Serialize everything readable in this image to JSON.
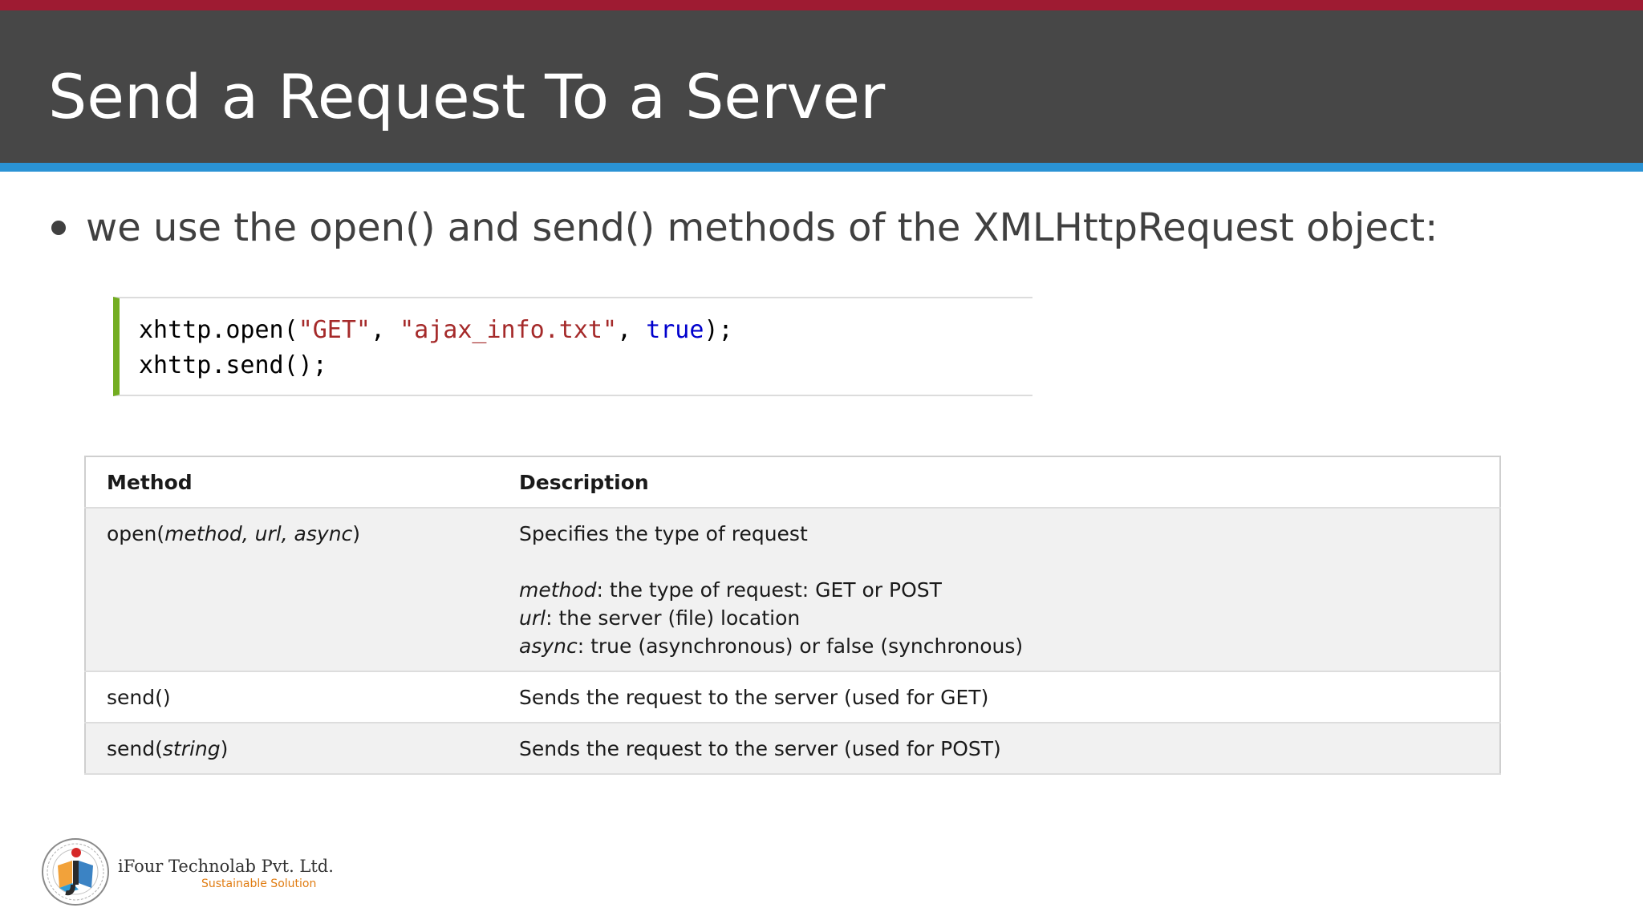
{
  "slide": {
    "title": "Send a Request To a Server",
    "bullet": "we use the open() and send() methods of the XMLHttpRequest object:"
  },
  "code": {
    "line1": {
      "prefix": "xhttp.open(",
      "arg1": "\"GET\"",
      "sep1": ", ",
      "arg2": "\"ajax_info.txt\"",
      "sep2": ", ",
      "arg3": "true",
      "suffix": ");"
    },
    "line2": "xhttp.send();"
  },
  "table": {
    "headers": [
      "Method",
      "Description"
    ],
    "rows": [
      {
        "method_name": "open(",
        "method_params": "method, url, async",
        "method_close": ")",
        "desc_line1": "Specifies the type of request",
        "params": [
          {
            "name": "method",
            "text": ": the type of request: GET or POST"
          },
          {
            "name": "url",
            "text": ": the server (file) location"
          },
          {
            "name": "async",
            "text": ": true (asynchronous) or false (synchronous)"
          }
        ]
      },
      {
        "method_name": "send()",
        "desc_line1": "Sends the request to the server (used for GET)"
      },
      {
        "method_name": "send(",
        "method_params": "string",
        "method_close": ")",
        "desc_line1": "Sends the request to the server (used for POST)"
      }
    ]
  },
  "footer": {
    "company": "iFour Technolab Pvt. Ltd.",
    "tagline": "Sustainable Solution"
  },
  "colors": {
    "top_stripe": "#9e1b32",
    "header_bg": "#474747",
    "blue_stripe": "#2a93d5",
    "code_accent": "#73ad21",
    "tagline": "#e07c12"
  },
  "icons": [
    "ifour-logo-icon"
  ]
}
